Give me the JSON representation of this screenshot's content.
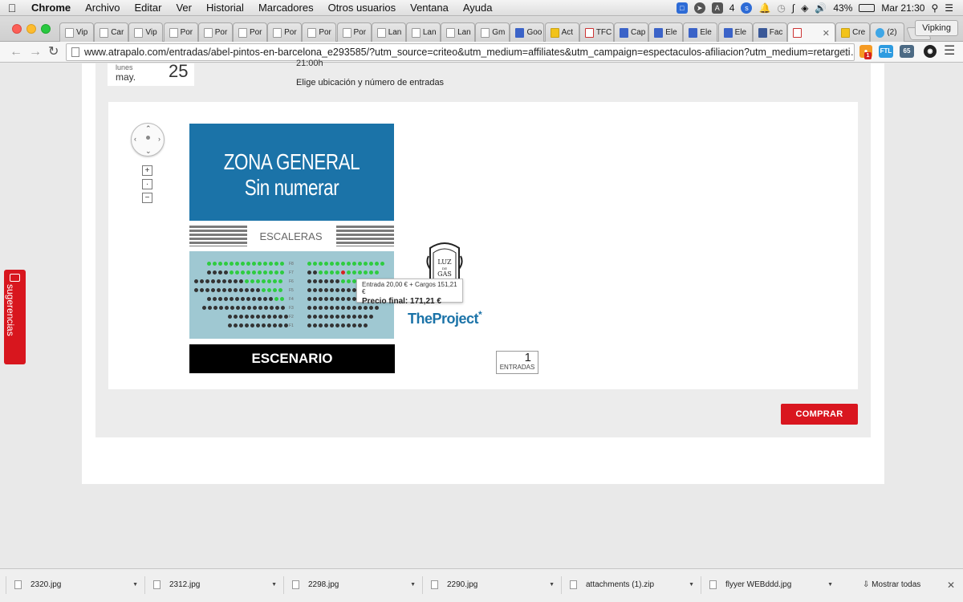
{
  "menubar": {
    "app": "Chrome",
    "items": [
      "Archivo",
      "Editar",
      "Ver",
      "Historial",
      "Marcadores",
      "Otros usuarios",
      "Ventana",
      "Ayuda"
    ],
    "adobe_count": "4",
    "battery": "43%",
    "clock": "Mar 21:30"
  },
  "tabs": [
    {
      "label": "Vip",
      "icon": "page-icon"
    },
    {
      "label": "Car",
      "icon": "page-icon"
    },
    {
      "label": "Vip",
      "icon": "page-icon"
    },
    {
      "label": "Por",
      "icon": "page-icon"
    },
    {
      "label": "Por",
      "icon": "page-icon"
    },
    {
      "label": "Por",
      "icon": "page-icon"
    },
    {
      "label": "Por",
      "icon": "page-icon"
    },
    {
      "label": "Por",
      "icon": "page-icon"
    },
    {
      "label": "Por",
      "icon": "page-icon"
    },
    {
      "label": "Lan",
      "icon": "page-icon"
    },
    {
      "label": "Lan",
      "icon": "page-icon"
    },
    {
      "label": "Lan",
      "icon": "page-icon"
    },
    {
      "label": "Gm",
      "icon": "page-icon"
    },
    {
      "label": "Goo",
      "icon": "google-icon"
    },
    {
      "label": "Act",
      "icon": "activity-icon"
    },
    {
      "label": "TFC",
      "icon": "gmail-icon"
    },
    {
      "label": "Cap",
      "icon": "k-icon"
    },
    {
      "label": "Ele",
      "icon": "k-icon"
    },
    {
      "label": "Ele",
      "icon": "k-icon"
    },
    {
      "label": "Ele",
      "icon": "k-icon"
    },
    {
      "label": "Fac",
      "icon": "facebook-icon"
    },
    {
      "label": "",
      "icon": "atrapalo-icon",
      "active": true
    },
    {
      "label": "Cre",
      "icon": "bulb-icon"
    },
    {
      "label": "(2)",
      "icon": "twitter-icon"
    }
  ],
  "profile_button": "Vipking",
  "url": "www.atrapalo.com/entradas/abel-pintos-en-barcelona_e293585/?utm_source=criteo&utm_medium=affiliates&utm_campaign=espectaculos-afiliacion?utm_medium=retargeti…",
  "extensions": {
    "ftl": "FTL",
    "counter": "65",
    "badge": "1"
  },
  "event": {
    "day_of_week": "lunes",
    "month": "may.",
    "day": "25",
    "time": "21:00h",
    "instruction": "Elige ubicación y número de entradas"
  },
  "map": {
    "zone_line1": "ZONA GENERAL",
    "zone_line2": "Sin numerar",
    "stairs": "ESCALERAS",
    "stage": "ESCENARIO",
    "row_labels": [
      "F8",
      "F7",
      "F6",
      "F5",
      "F4",
      "F3",
      "F2",
      "F1"
    ],
    "venue_logo_text": "LUZ DE GAS",
    "sponsor": "TheProject",
    "sponsor_mark": "*",
    "colors": {
      "available": "#2ecc40",
      "occupied": "#333333",
      "selected": "#d62020",
      "zone": "#1b73a8",
      "seating_bg": "#9fc8d2"
    }
  },
  "tooltip": {
    "line1": "Entrada 20,00 € + Cargos 151,21 €",
    "line2": "Precio final: 171,21 €"
  },
  "tickets": {
    "count": "1",
    "label": "ENTRADAS"
  },
  "buy_button": "COMPRAR",
  "feedback_tab": "sugerencias",
  "downloads": [
    {
      "name": "2320.jpg"
    },
    {
      "name": "2312.jpg"
    },
    {
      "name": "2298.jpg"
    },
    {
      "name": "2290.jpg"
    },
    {
      "name": "attachments (1).zip"
    },
    {
      "name": "flyyer WEBddd.jpg"
    }
  ],
  "show_all": "Mostrar todas"
}
